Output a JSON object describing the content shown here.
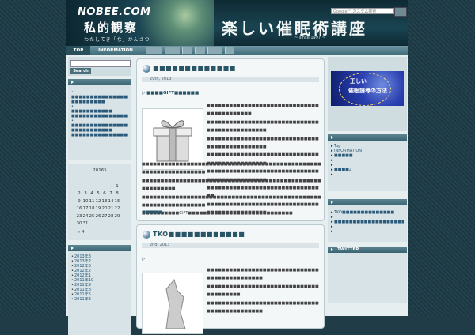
{
  "header": {
    "logo_en": "NOBEE.COM",
    "logo_jp": "私的観察",
    "logo_sub": "わたしてき「な」かんさつ",
    "title": "楽しい催眠術講座",
    "since": "~ since 1997 ~",
    "search_placeholder": "Google™ カスタム検索"
  },
  "nav": {
    "items": [
      "TOP",
      "INFORMATION"
    ]
  },
  "left_sidebar": {
    "search_button": "Search",
    "links1": [
      "•",
      "■■■■■■■■■■■■■■■■■■",
      "■■■■■■■■■",
      "•",
      "■■■■■■■■■■■",
      "■■■■■■■■■■■■■■■■■",
      "•",
      "■■■■■■■■■■■■■■■■■■■■■■",
      "■■■■■■■■■■■",
      "■■■■■■■■■■■■■■■■■"
    ],
    "calendar": {
      "caption": "20165",
      "rows": [
        [
          "",
          "",
          "",
          "",
          "",
          "",
          "1"
        ],
        [
          "2",
          "3",
          "4",
          "5",
          "6",
          "7",
          "8"
        ],
        [
          "9",
          "10",
          "11",
          "12",
          "13",
          "14",
          "15"
        ],
        [
          "16",
          "17",
          "18",
          "19",
          "20",
          "21",
          "22"
        ],
        [
          "23",
          "24",
          "25",
          "26",
          "27",
          "28",
          "29"
        ],
        [
          "30",
          "31",
          "",
          "",
          "",
          "",
          ""
        ]
      ],
      "prev": "« 4"
    },
    "archives": [
      "2013年3",
      "2013年2",
      "2012年3",
      "2012年2",
      "2012年1",
      "2011年10",
      "2011年9",
      "2011年8",
      "2011年5",
      "2011年3"
    ]
  },
  "posts": [
    {
      "title": "■■■■■■■■■■■■■",
      "date": "29th, 2013",
      "category": "■■■■GIFT■■■■■■",
      "lines": [
        "■■■■■■■■■■■■■■■■■■■■■■■■■■■■■■■■■■■■■■■■■■",
        "■■■■■■■■■■■■■■■■■■■■■■■■■■■■■■■■■■■■■■■■■■■■■■",
        "■■■■■■■■■■■■■■■■■■■■■■■■■■■■■■■■■■■■■■■■■■■■■■",
        "■■■■■■■■■■■■■■■■■■■■■■■■■■■■■■■■■■■■■■■■■■■■■■",
        "■■■■■■■■■■■■■■■■■■■■■■■■■■■■■■■■■■■■■■■■■■■■■■",
        "■■■■■■■■■■■■■■■■■■■■■■■■■■■■■■■■",
        "■■■■■■■■■■■■■■■■■■■■■■■■■■■■■■■■■■■■■■■■■■■■■■",
        "■■■■■■■■■■■■■■■■■■■■■■■■■■■■■■■■■■■■■■■■■■■■■■■■■■■■■■■■■■■■■■■■■",
        "■■■■■■■■■■■■■■■■■■■■■■■■■■■■■■■■■■■■■■■■■■■■■■■■■■■■■■■■■",
        "■■■■■■■■■■■■■■■■■■■■■■■■■■■■■■■■■■■■■■■■■■■■■■■■■■■■■■■■■■■■■■■■■",
        "■■■■■■■■■■GIFT■■■■■■■■■■■■■■■■■■■■■■■■■■■■"
      ],
      "read_more": "■■■■■ »"
    },
    {
      "title": "TKO■■■■■■■■■■■■",
      "date": "2nd, 2013",
      "lines": [
        "■■■■■■■■■■■■■■■■■■■■■■■■■■■■■■■■■■■■■■■■■■■■■",
        "■■■■■■■■■■■■■■■■■■■■■■■■■■■■■■",
        "■■■■■■■■■",
        "■■■■■■■■■■■■■■■■■■■■■■■■■■■■■■■■■■■■■■■■■■■■■"
      ]
    }
  ],
  "right_sidebar": {
    "banner_line1": "正しい",
    "banner_line2": "催眠誘導の方法",
    "links1": [
      "Top",
      "INFORMATION",
      "■■■■■",
      "",
      "",
      "■■■■Z",
      ""
    ],
    "links2": [
      "TKO■■■■■■■■■■■■■■",
      "",
      "■■■■■■■■■■■■■■■■■■■■■■",
      "",
      ""
    ],
    "twitter": "TWITTER"
  }
}
